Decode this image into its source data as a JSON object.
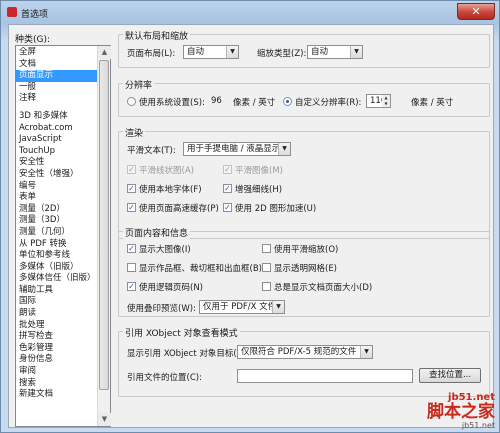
{
  "window": {
    "title": "首选项",
    "close_glyph": "✕"
  },
  "categories": {
    "label": "种类(G):",
    "group1": [
      "全屏",
      "文档",
      "页面显示",
      "一般",
      "注释"
    ],
    "selected": "页面显示",
    "group2": [
      "3D 和多媒体",
      "Acrobat.com",
      "JavaScript",
      "TouchUp",
      "安全性",
      "安全性（增强）",
      "编号",
      "表单",
      "测量（2D）",
      "测量（3D）",
      "测量（几何）",
      "从 PDF 转换",
      "单位和参考线",
      "多媒体（旧版）",
      "多媒体信任（旧版）",
      "辅助工具",
      "国际",
      "朗读",
      "批处理",
      "拼写检查",
      "色彩管理",
      "身份信息",
      "审阅",
      "搜索",
      "新建文档"
    ]
  },
  "layout": {
    "title": "默认布局和缩放",
    "page_layout_label": "页面布局(L):",
    "page_layout_value": "自动",
    "zoom_label": "缩放类型(Z):",
    "zoom_value": "自动"
  },
  "resolution": {
    "title": "分辨率",
    "system_label": "使用系统设置(S):",
    "system_value": "96",
    "system_unit": "像素 / 英寸",
    "custom_label": "自定义分辨率(R):",
    "custom_value": "110",
    "custom_unit": "像素 / 英寸",
    "selected": "custom"
  },
  "render": {
    "title": "渲染",
    "smooth_text_label": "平滑文本(T):",
    "smooth_text_value": "用于手提电脑 / 液晶显示屏",
    "smooth_line_art": "平滑线状图(A)",
    "smooth_images": "平滑图像(M)",
    "local_fonts": "使用本地字体(F)",
    "enhance_thin_lines": "增强细线(H)",
    "page_cache": "使用页面高速缓存(P)",
    "accel_2d": "使用 2D 图形加速(U)"
  },
  "content": {
    "title": "页面内容和信息",
    "large_images": "显示大图像(I)",
    "smooth_zoom": "使用平滑缩放(O)",
    "art_trim_bleed": "显示作品框、裁切框和出血框(B)",
    "transparency_grid": "显示透明网格(E)",
    "logical_page_numbers": "使用逻辑页码(N)",
    "always_page_size": "总是显示文档页面大小(D)",
    "overprint_label": "使用叠印预览(W):",
    "overprint_value": "仅用于 PDF/X 文件"
  },
  "xobject": {
    "title": "引用 XObject 对象查看模式",
    "show_targets_label": "显示引用 XObject 对象目标(X):",
    "show_targets_value": "仅限符合 PDF/X-5 规范的文件",
    "file_location_label": "引用文件的位置(C):",
    "browse_button": "查找位置..."
  },
  "watermark": {
    "url": "jb51.net",
    "main": "脚本之家",
    "sub": "jb51.net"
  }
}
